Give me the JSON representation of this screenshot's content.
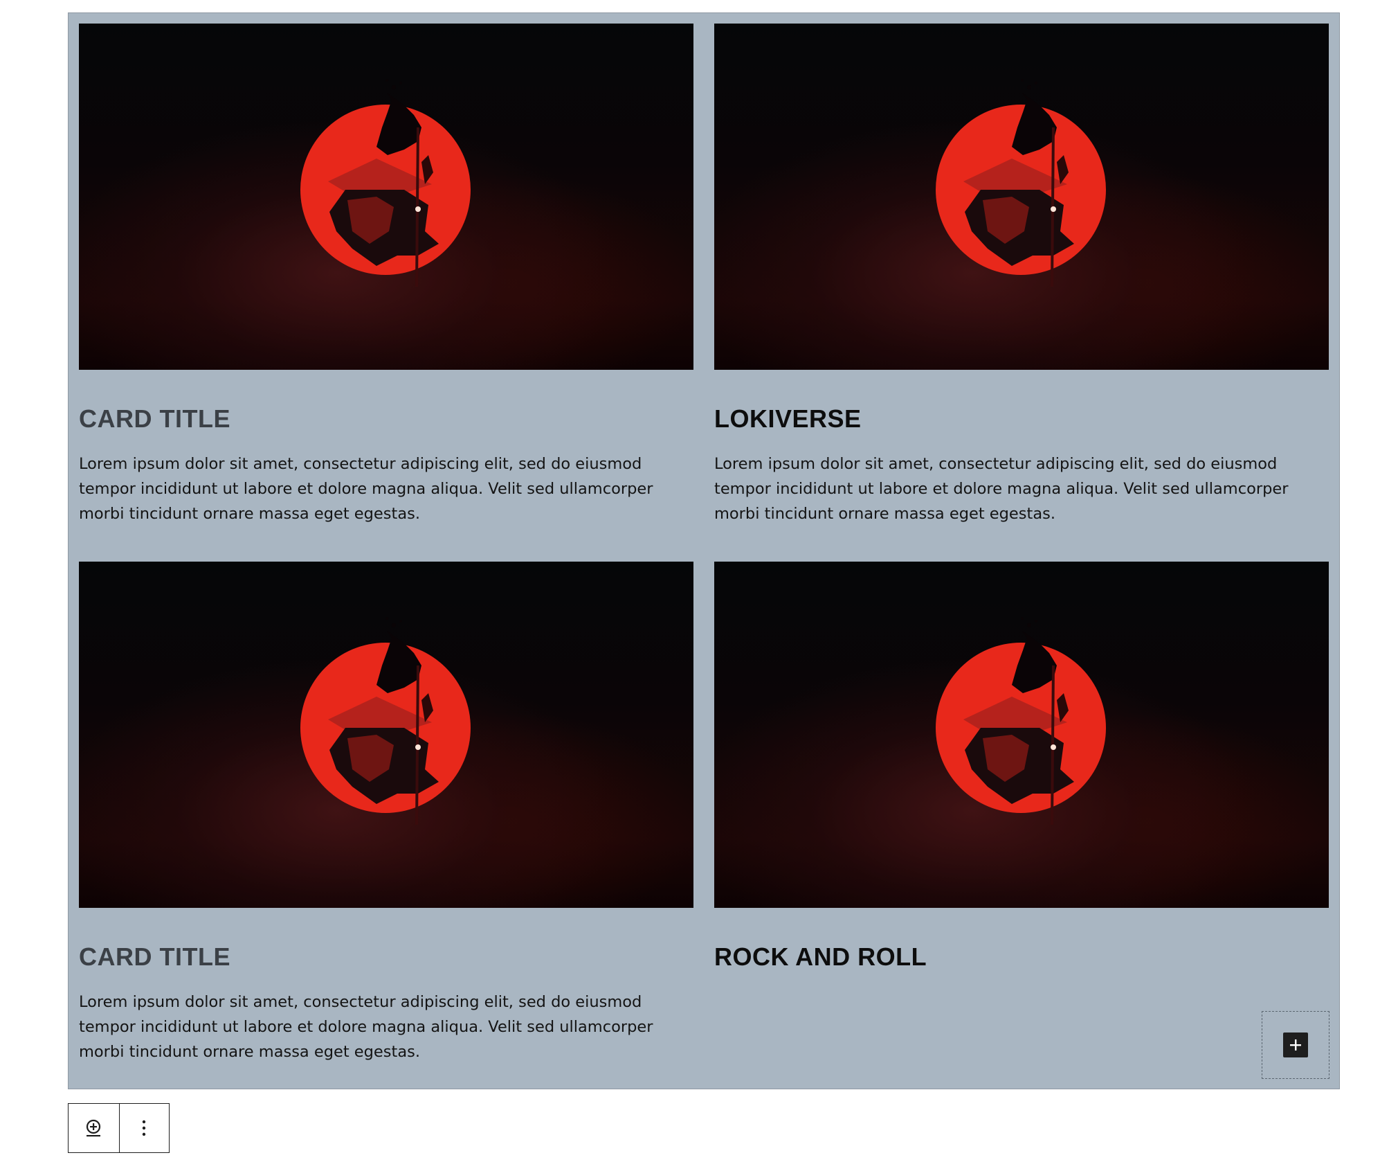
{
  "cards": [
    {
      "image_alt": "samurai-red-sun-artwork",
      "title": "CARD TITLE",
      "text": "Lorem ipsum dolor sit amet, consectetur adipiscing elit, sed do eiusmod tempor incididunt ut labore et dolore magna aliqua. Velit sed ullamcorper morbi tincidunt ornare massa eget egestas."
    },
    {
      "image_alt": "samurai-red-sun-artwork",
      "title": "LOKIVERSE",
      "text": "Lorem ipsum dolor sit amet, consectetur adipiscing elit, sed do eiusmod tempor incididunt ut labore et dolore magna aliqua. Velit sed ullamcorper morbi tincidunt ornare massa eget egestas."
    },
    {
      "image_alt": "samurai-red-sun-artwork",
      "title": "CARD TITLE",
      "text": "Lorem ipsum dolor sit amet, consectetur adipiscing elit, sed do eiusmod tempor incididunt ut labore et dolore magna aliqua. Velit sed ullamcorper morbi tincidunt ornare massa eget egestas."
    },
    {
      "image_alt": "samurai-red-sun-artwork",
      "title": "ROCK AND ROLL",
      "text": ""
    }
  ],
  "appender": {
    "icon": "plus-icon"
  },
  "toolbar": {
    "add_icon": "add-block-icon",
    "options_icon": "more-vertical-icon"
  },
  "colors": {
    "container_bg": "#a9b6c2",
    "sun_red": "#e8281b",
    "title_muted": "#3b4046",
    "title_strong": "#0d0d0d"
  }
}
